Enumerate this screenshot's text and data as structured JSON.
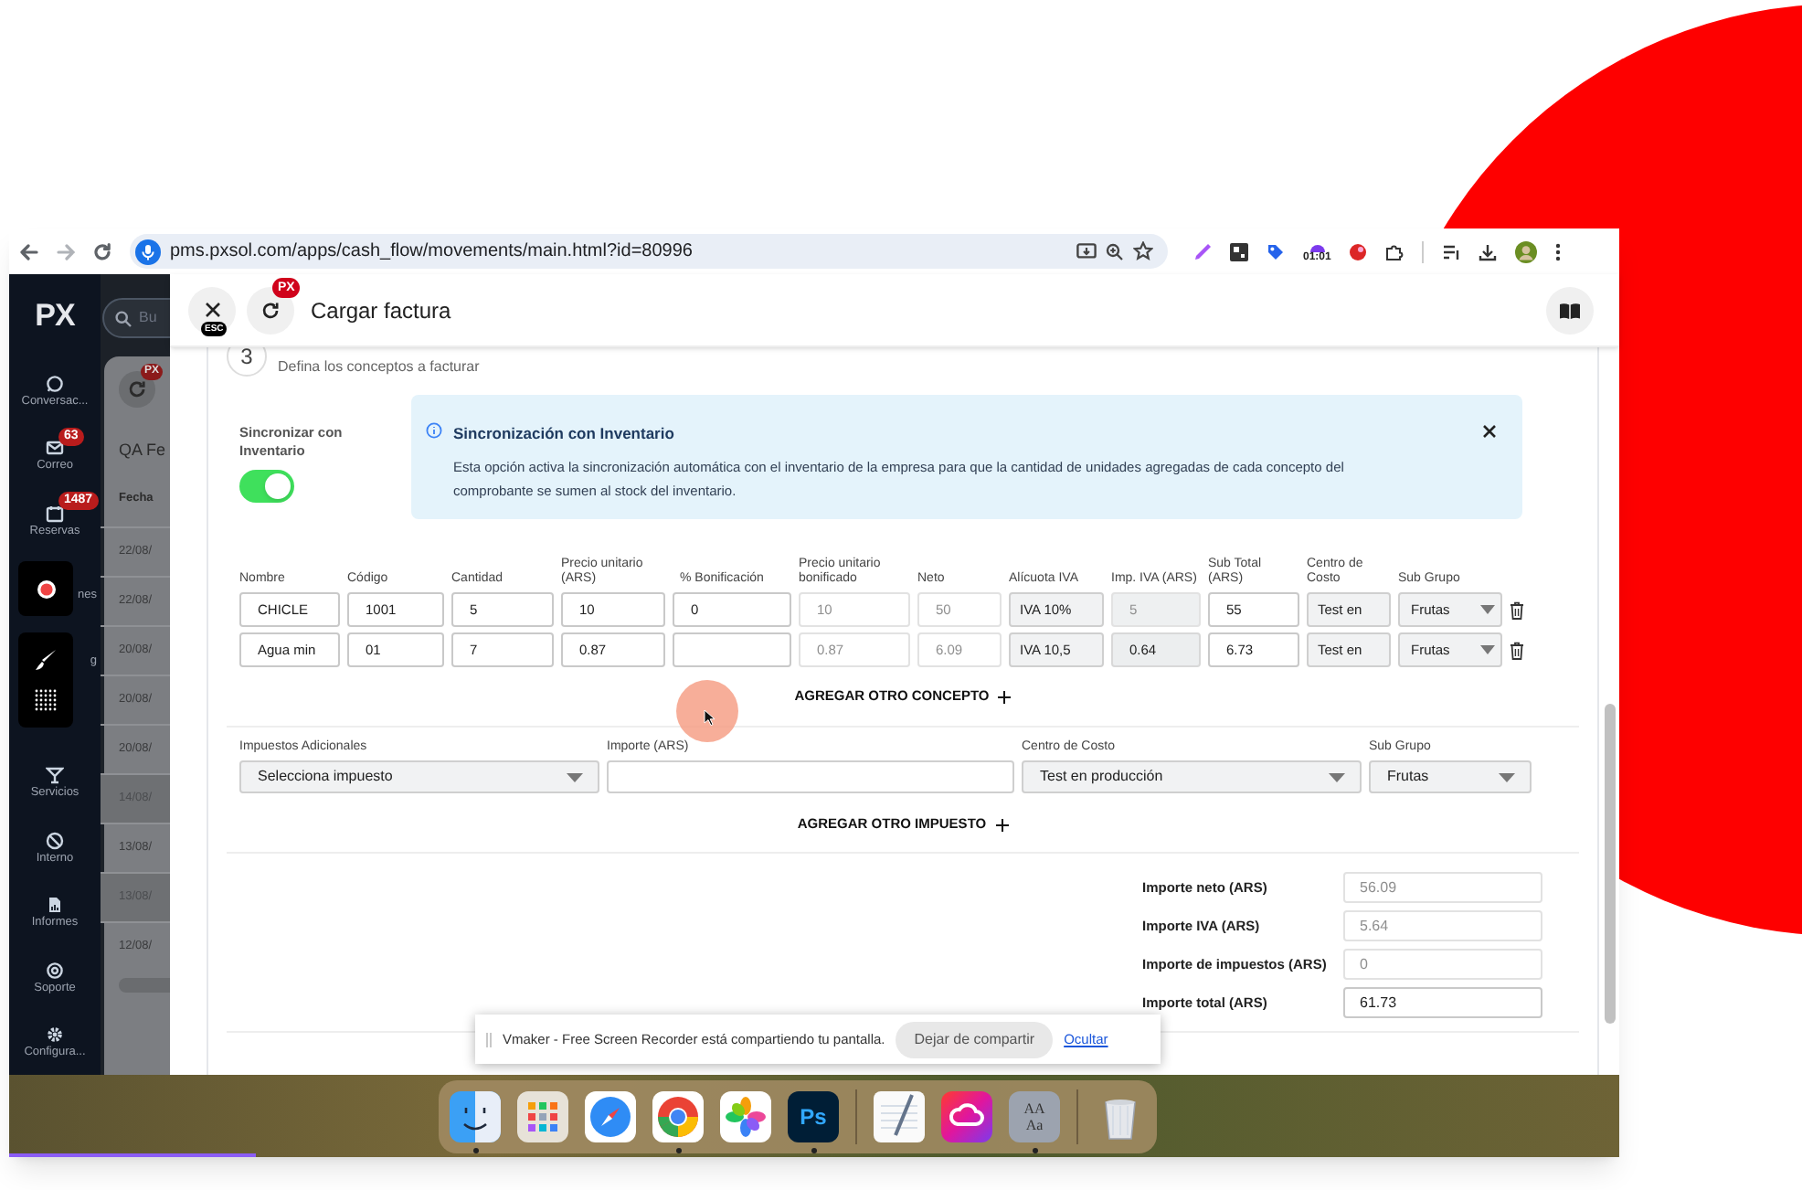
{
  "browser": {
    "url": "pms.pxsol.com/apps/cash_flow/movements/main.html?id=80996",
    "extension_timer": "01:01"
  },
  "sidebar": {
    "logo": "PX",
    "items": [
      {
        "label": "Conversac..."
      },
      {
        "label": "Correo",
        "badge": "63"
      },
      {
        "label": "Reservas",
        "badge": "1487"
      },
      {
        "label": "nes"
      },
      {
        "label": "g"
      },
      {
        "label": "Servicios"
      },
      {
        "label": "Interno"
      },
      {
        "label": "Informes"
      },
      {
        "label": "Soporte"
      },
      {
        "label": "Configura..."
      }
    ]
  },
  "background_page": {
    "search_placeholder": "Bu",
    "badge": "PX",
    "title": "QA Fe",
    "column_header": "Fecha",
    "rows": [
      {
        "date": "22/08/",
        "selected": false
      },
      {
        "date": "22/08/",
        "selected": false
      },
      {
        "date": "20/08/",
        "selected": false
      },
      {
        "date": "20/08/",
        "selected": false
      },
      {
        "date": "20/08/",
        "selected": false
      },
      {
        "date": "14/08/",
        "selected": true
      },
      {
        "date": "13/08/",
        "selected": false
      },
      {
        "date": "13/08/",
        "selected": true
      },
      {
        "date": "12/08/",
        "selected": false
      }
    ]
  },
  "modal": {
    "title": "Cargar factura",
    "close_shortcut": "ESC",
    "refresh_badge": "PX",
    "step": {
      "number": "3",
      "subtitle": "Defina los conceptos a facturar"
    },
    "sync": {
      "label": "Sincronizar con Inventario",
      "on": true
    },
    "alert": {
      "title": "Sincronización con Inventario",
      "text": "Esta opción activa la sincronización automática con el inventario de la empresa para que la cantidad de unidades agregadas de cada concepto del comprobante se sumen al stock del inventario."
    },
    "concepts": {
      "columns": [
        "Nombre",
        "Código",
        "Cantidad",
        "Precio unitario (ARS)",
        "% Bonificación",
        "Precio unitario bonificado",
        "Neto",
        "Alícuota IVA",
        "Imp. IVA (ARS)",
        "Sub Total (ARS)",
        "Centro de Costo",
        "Sub Grupo"
      ],
      "rows": [
        {
          "cells": [
            {
              "kind": "input",
              "value": "CHICLE"
            },
            {
              "kind": "input",
              "value": "1001"
            },
            {
              "kind": "input",
              "value": "5"
            },
            {
              "kind": "input",
              "value": "10"
            },
            {
              "kind": "input",
              "value": "0"
            },
            {
              "kind": "disabled",
              "value": "10"
            },
            {
              "kind": "disabled",
              "value": "50"
            },
            {
              "kind": "select",
              "value": "IVA 10%"
            },
            {
              "kind": "readonly",
              "value": "5"
            },
            {
              "kind": "input",
              "value": "55"
            },
            {
              "kind": "select",
              "value": "Test en"
            },
            {
              "kind": "select",
              "value": "Frutas"
            }
          ]
        },
        {
          "cells": [
            {
              "kind": "input",
              "value": "Agua min"
            },
            {
              "kind": "input",
              "value": "01"
            },
            {
              "kind": "input",
              "value": "7"
            },
            {
              "kind": "input",
              "value": "0.87"
            },
            {
              "kind": "input"
            },
            {
              "kind": "disabled",
              "value": "0.87"
            },
            {
              "kind": "disabled",
              "value": "6.09"
            },
            {
              "kind": "select",
              "value": "IVA 10,5"
            },
            {
              "kind": "computed",
              "value": "0.64"
            },
            {
              "kind": "input",
              "value": "6.73"
            },
            {
              "kind": "select",
              "value": "Test en"
            },
            {
              "kind": "select",
              "value": "Frutas"
            }
          ]
        }
      ]
    },
    "add_concept": "AGREGAR OTRO CONCEPTO",
    "taxes": [
      {
        "label": "Impuestos Adicionales",
        "kind": "select",
        "value": "Selecciona impuesto"
      },
      {
        "label": "Importe (ARS)",
        "kind": "input"
      },
      {
        "label": "Centro de Costo",
        "kind": "select",
        "value": "Test en producción"
      },
      {
        "label": "Sub Grupo",
        "kind": "select",
        "value": "Frutas"
      }
    ],
    "add_tax": "AGREGAR OTRO IMPUESTO",
    "totals": [
      {
        "label": "Importe neto (ARS)",
        "value": "56.09",
        "kind": "disabled"
      },
      {
        "label": "Importe IVA (ARS)",
        "value": "5.64",
        "kind": "disabled"
      },
      {
        "label": "Importe de impuestos (ARS)",
        "value": "0",
        "kind": "disabled"
      },
      {
        "label": "Importe total (ARS)",
        "value": "61.73",
        "kind": "input"
      }
    ]
  },
  "share_bar": {
    "message": "Vmaker - Free Screen Recorder está compartiendo tu pantalla.",
    "stop_button": "Dejar de compartir",
    "hide_link": "Ocultar"
  },
  "dock": [
    {
      "kind": "finder",
      "running": true
    },
    {
      "kind": "launchpad",
      "running": false
    },
    {
      "kind": "safari",
      "running": false
    },
    {
      "kind": "chrome",
      "running": true
    },
    {
      "kind": "photos",
      "running": false
    },
    {
      "kind": "photoshop",
      "label": "Ps",
      "running": true
    },
    {
      "kind": "separator"
    },
    {
      "kind": "textedit",
      "running": false
    },
    {
      "kind": "creative-cloud",
      "running": false
    },
    {
      "kind": "fontbook",
      "label": "AA Aa",
      "running": true
    },
    {
      "kind": "separator"
    },
    {
      "kind": "trash",
      "running": false
    }
  ]
}
